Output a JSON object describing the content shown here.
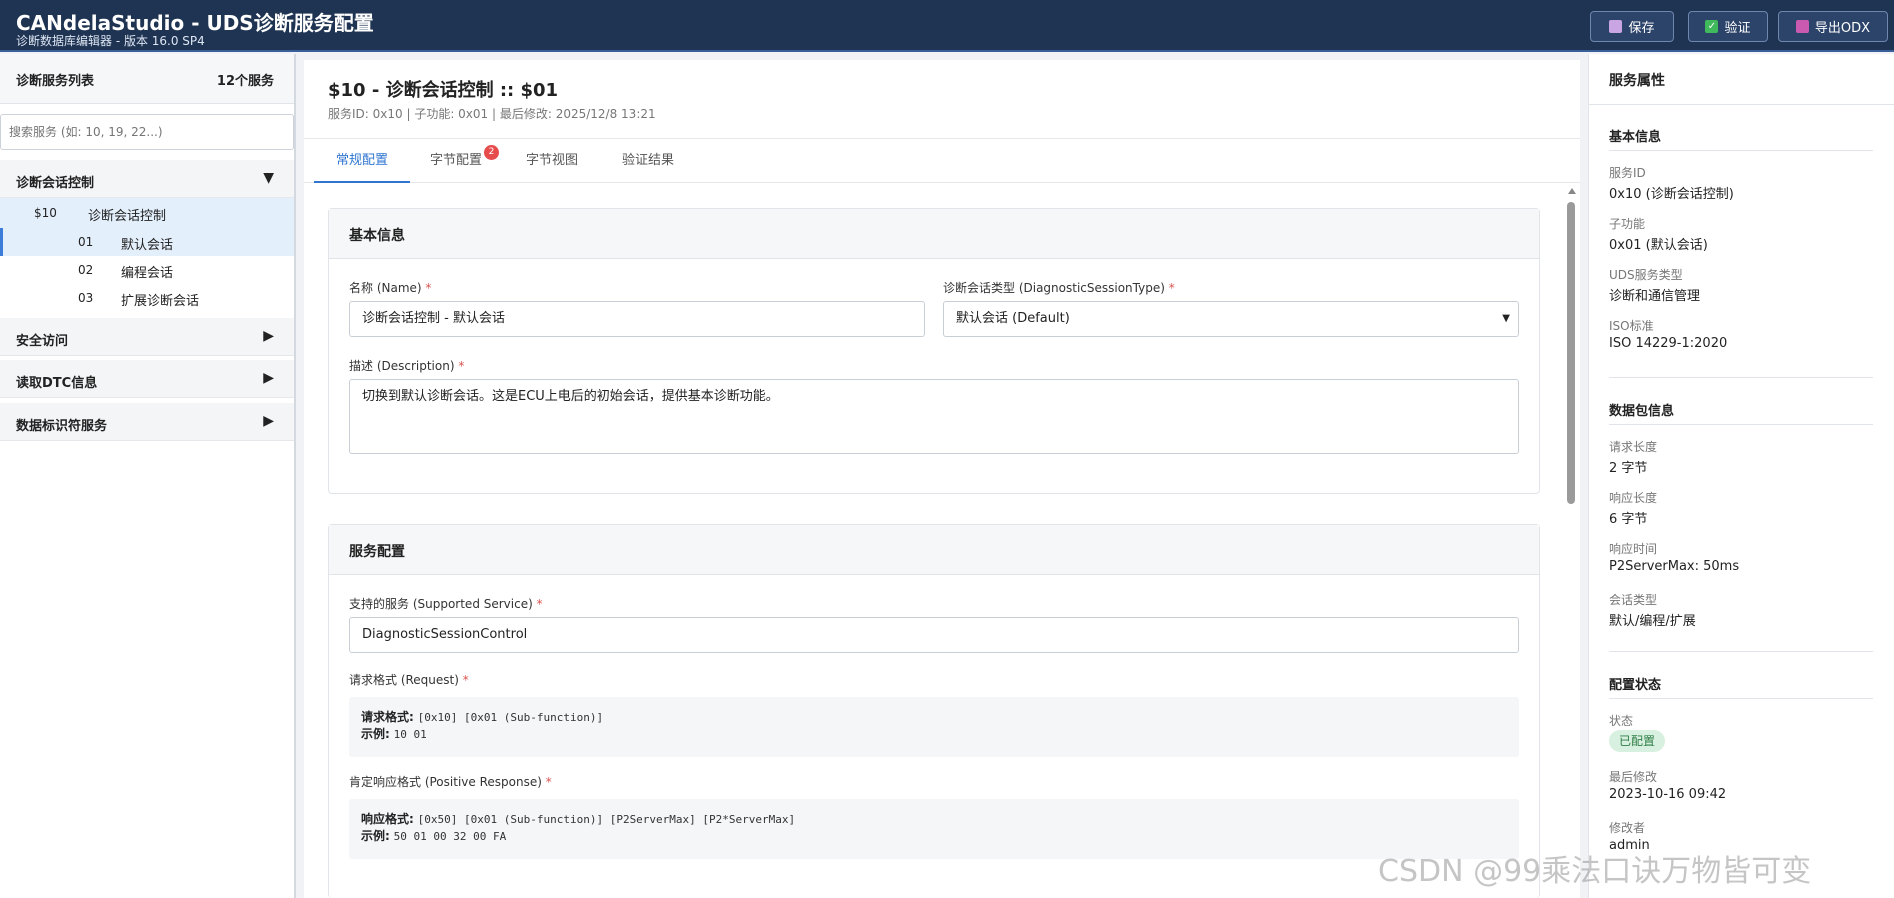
{
  "header": {
    "title": "CANdelaStudio - UDS诊断服务配置",
    "subtitle": "诊断数据库编辑器 - 版本 16.0 SP4",
    "buttons": {
      "save": "保存",
      "validate": "验证",
      "export": "导出ODX"
    }
  },
  "sidebar": {
    "title": "诊断服务列表",
    "count": "12个服务",
    "search_placeholder": "搜索服务 (如: 10, 19, 22...)",
    "groups": [
      {
        "label": "诊断会话控制",
        "expanded": true
      },
      {
        "label": "安全访问",
        "expanded": false
      },
      {
        "label": "读取DTC信息",
        "expanded": false
      },
      {
        "label": "数据标识符服务",
        "expanded": false
      }
    ],
    "service": {
      "code": "$10",
      "label": "诊断会话控制"
    },
    "subfunctions": [
      {
        "code": "01",
        "label": "默认会话",
        "selected": true
      },
      {
        "code": "02",
        "label": "编程会话",
        "selected": false
      },
      {
        "code": "03",
        "label": "扩展诊断会话",
        "selected": false
      }
    ],
    "arrow_down": "▼",
    "arrow_right": "▶"
  },
  "main": {
    "title": "$10 - 诊断会话控制 :: $01",
    "meta": "服务ID: 0x10 | 子功能: 0x01 | 最后修改: 2025/12/8 13:21",
    "tabs": [
      {
        "label": "常规配置",
        "active": true
      },
      {
        "label": "字节配置",
        "badge": "2"
      },
      {
        "label": "字节视图"
      },
      {
        "label": "验证结果"
      }
    ],
    "basic": {
      "title": "基本信息",
      "name_label": "名称 (Name)",
      "name_value": "诊断会话控制 - 默认会话",
      "type_label": "诊断会话类型 (DiagnosticSessionType)",
      "type_value": "默认会话 (Default)",
      "desc_label": "描述 (Description)",
      "desc_value": "切换到默认诊断会话。这是ECU上电后的初始会话，提供基本诊断功能。"
    },
    "service_config": {
      "title": "服务配置",
      "supported_label": "支持的服务 (Supported Service)",
      "supported_value": "DiagnosticSessionControl",
      "request_label": "请求格式 (Request)",
      "request_format_key": "请求格式:",
      "request_format_val": "[0x10] [0x01 (Sub-function)]",
      "request_example_key": "示例:",
      "request_example_val": "10 01",
      "response_label": "肯定响应格式 (Positive Response)",
      "response_format_key": "响应格式:",
      "response_format_val": "[0x50] [0x01 (Sub-function)] [P2ServerMax] [P2*ServerMax]",
      "response_example_key": "示例:",
      "response_example_val": "50 01 00 32 00 FA"
    },
    "required_mark": "*"
  },
  "properties": {
    "title": "服务属性",
    "basic_title": "基本信息",
    "service_id_label": "服务ID",
    "service_id_value": "0x10 (诊断会话控制)",
    "subfunction_label": "子功能",
    "subfunction_value": "0x01 (默认会话)",
    "uds_type_label": "UDS服务类型",
    "uds_type_value": "诊断和通信管理",
    "iso_label": "ISO标准",
    "iso_value": "ISO 14229-1:2020",
    "packet_title": "数据包信息",
    "req_len_label": "请求长度",
    "req_len_value": "2 字节",
    "resp_len_label": "响应长度",
    "resp_len_value": "6 字节",
    "resp_time_label": "响应时间",
    "resp_time_value": "P2ServerMax: 50ms",
    "session_type_label": "会话类型",
    "session_type_value": "默认/编程/扩展",
    "config_title": "配置状态",
    "state_label": "状态",
    "state_value": "已配置",
    "last_mod_label": "最后修改",
    "last_mod_value": "2023-10-16 09:42",
    "modifier_label": "修改者",
    "modifier_value": "admin"
  },
  "watermark": "CSDN @99乘法口诀万物皆可变",
  "colors": {
    "header_bg": "#1f3352",
    "accent": "#2f75d0",
    "badge": "#e74c4c",
    "status_bg": "#d8f0df",
    "status_fg": "#2e7d46"
  }
}
